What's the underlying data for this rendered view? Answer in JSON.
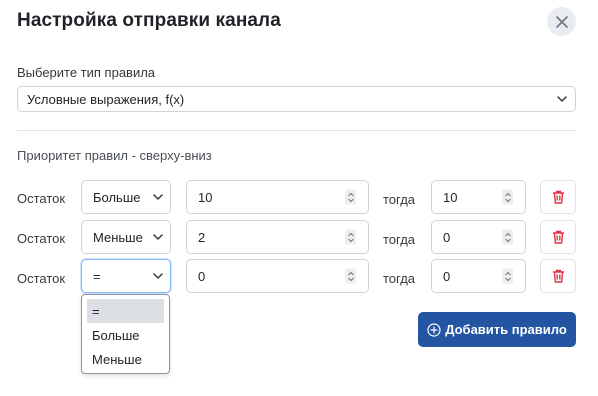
{
  "modal": {
    "title": "Настройка отправки канала",
    "close_icon": "close-icon"
  },
  "rule_type": {
    "label": "Выберите тип правила",
    "selected": "Условные выражения, f(x)"
  },
  "priority_label": "Приоритет правил - сверху-вниз",
  "rules": [
    {
      "label": "Остаток",
      "operator": "Больше",
      "value": "10",
      "then_label": "тогда",
      "result": "10"
    },
    {
      "label": "Остаток",
      "operator": "Меньше",
      "value": "2",
      "then_label": "тогда",
      "result": "0"
    },
    {
      "label": "Остаток",
      "operator": "=",
      "value": "0",
      "then_label": "тогда",
      "result": "0"
    }
  ],
  "operator_dropdown": {
    "options": [
      "=",
      "Больше",
      "Меньше"
    ],
    "selected": "="
  },
  "add_button": {
    "label": "Добавить правило",
    "icon": "plus-circle-icon"
  },
  "colors": {
    "primary": "#2355a3",
    "danger": "#dc3545",
    "close_bg": "#e9edf1"
  }
}
